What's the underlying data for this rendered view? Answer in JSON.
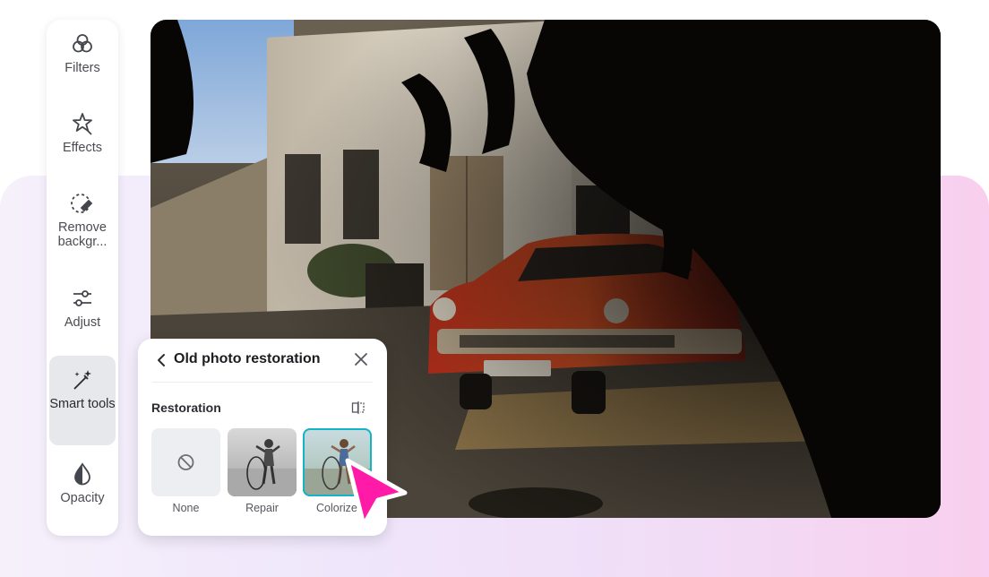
{
  "sidebar": {
    "items": [
      {
        "label": "Filters",
        "icon": "filters-icon",
        "active": false
      },
      {
        "label": "Effects",
        "icon": "effects-icon",
        "active": false
      },
      {
        "label": "Remove backgr...",
        "icon": "remove-background-icon",
        "active": false
      },
      {
        "label": "Adjust",
        "icon": "adjust-icon",
        "active": false
      },
      {
        "label": "Smart tools",
        "icon": "smart-tools-icon",
        "active": true
      },
      {
        "label": "Opacity",
        "icon": "opacity-icon",
        "active": false
      }
    ]
  },
  "panel": {
    "title": "Old photo restoration",
    "section_label": "Restoration",
    "options": [
      {
        "label": "None",
        "selected": false
      },
      {
        "label": "Repair",
        "selected": false
      },
      {
        "label": "Colorize",
        "selected": true
      }
    ]
  },
  "colors": {
    "accent": "#14b3c6",
    "cursor": "#ff1aa8",
    "active_item_bg": "#e6e8ec"
  }
}
